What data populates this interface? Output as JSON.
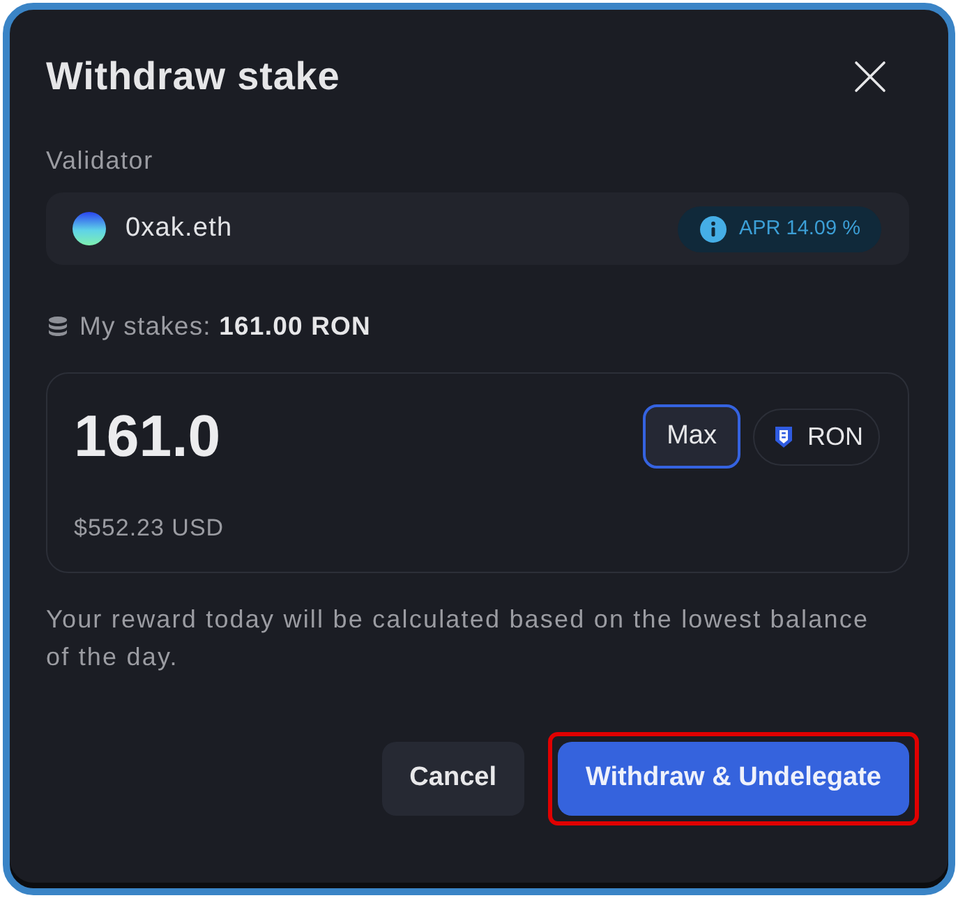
{
  "dialog": {
    "title": "Withdraw stake"
  },
  "validator": {
    "label": "Validator",
    "name": "0xak.eth",
    "apr": "APR 14.09 %"
  },
  "stakes": {
    "text": "My stakes: **161.00 RON**"
  },
  "amount": {
    "value": "161.0",
    "usd": "$552.23 USD",
    "max": {
      "label": "Max",
      "focused": true
    },
    "token": "RON"
  },
  "note": "Your reward today will be calculated based on the lowest balance of the day.",
  "buttons": [
    {
      "label": "Cancel",
      "kind": "secondary",
      "highlighted": false
    },
    {
      "label": "Withdraw & Undelegate",
      "kind": "primary",
      "highlighted": true
    }
  ]
}
